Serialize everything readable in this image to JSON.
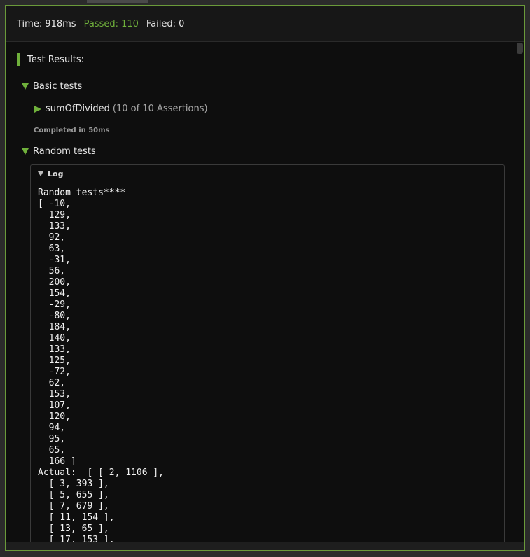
{
  "stats": {
    "time": "Time: 918ms",
    "passed": "Passed: 110",
    "failed": "Failed: 0"
  },
  "results": {
    "header": "Test Results:",
    "groups": [
      {
        "title": "Basic tests",
        "test": {
          "name": "sumOfDivided",
          "assertions": "(10 of 10 Assertions)"
        },
        "completed": "Completed in 50ms"
      },
      {
        "title": "Random tests",
        "log_label": "Log",
        "log_lines": [
          "Random tests****",
          "[ -10,",
          "  129,",
          "  133,",
          "  92,",
          "  63,",
          "  -31,",
          "  56,",
          "  200,",
          "  154,",
          "  -29,",
          "  -80,",
          "  184,",
          "  140,",
          "  133,",
          "  125,",
          "  -72,",
          "  62,",
          "  153,",
          "  107,",
          "  120,",
          "  94,",
          "  95,",
          "  65,",
          "  166 ]",
          "Actual:  [ [ 2, 1106 ],",
          "  [ 3, 393 ],",
          "  [ 5, 655 ],",
          "  [ 7, 679 ],",
          "  [ 11, 154 ],",
          "  [ 13, 65 ],",
          "  [ 17, 153 ],"
        ]
      }
    ]
  },
  "colors": {
    "accent": "#6fb03b",
    "border": "#6a9a3a",
    "background": "#0e0e0e"
  }
}
